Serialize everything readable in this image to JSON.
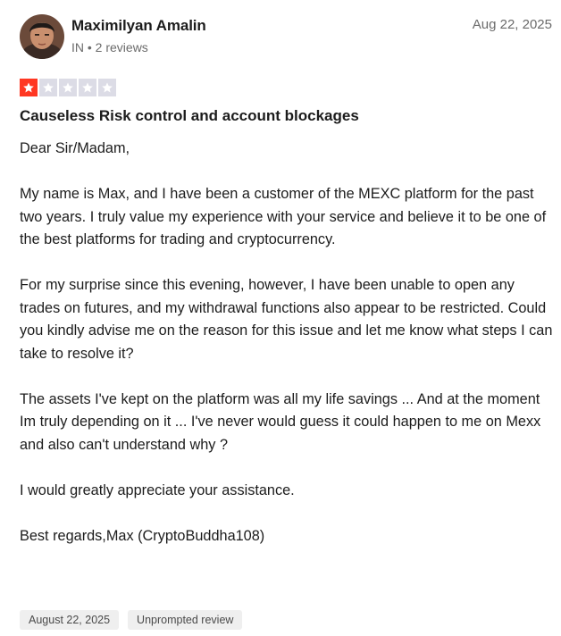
{
  "reviewer": {
    "name": "Maximilyan Amalin",
    "meta": "IN • 2 reviews",
    "avatar": "avatar-photo"
  },
  "review": {
    "date": "Aug 22, 2025",
    "rating": 1,
    "rating_max": 5,
    "title": "Causeless Risk control and account blockages",
    "paragraphs": [
      "Dear Sir/Madam,",
      "My name is Max, and I have been a customer of the MEXC platform for the past two years. I truly value my experience with your service and believe it to be one of the best platforms for trading and cryptocurrency.",
      "For my surprise since this evening, however, I have been unable to open any trades on futures, and my withdrawal functions also appear to be restricted. Could you kindly advise me on the reason for this issue and let me know what steps I can take to resolve it?",
      "The assets I've kept on the platform was all my life savings ... And at the moment Im truly depending on it ... I've never would guess it could happen to me on Mexx and also can't understand why ?",
      "I would greatly appreciate your assistance.",
      "Best regards,Max (CryptoBuddha108)"
    ]
  },
  "tags": {
    "experience_date": "August 22, 2025",
    "review_type": "Unprompted review"
  },
  "colors": {
    "star_filled": "#ff3722",
    "star_empty": "#dcdce6",
    "tag_bg": "#efefef",
    "muted_text": "#6b6b6b"
  }
}
